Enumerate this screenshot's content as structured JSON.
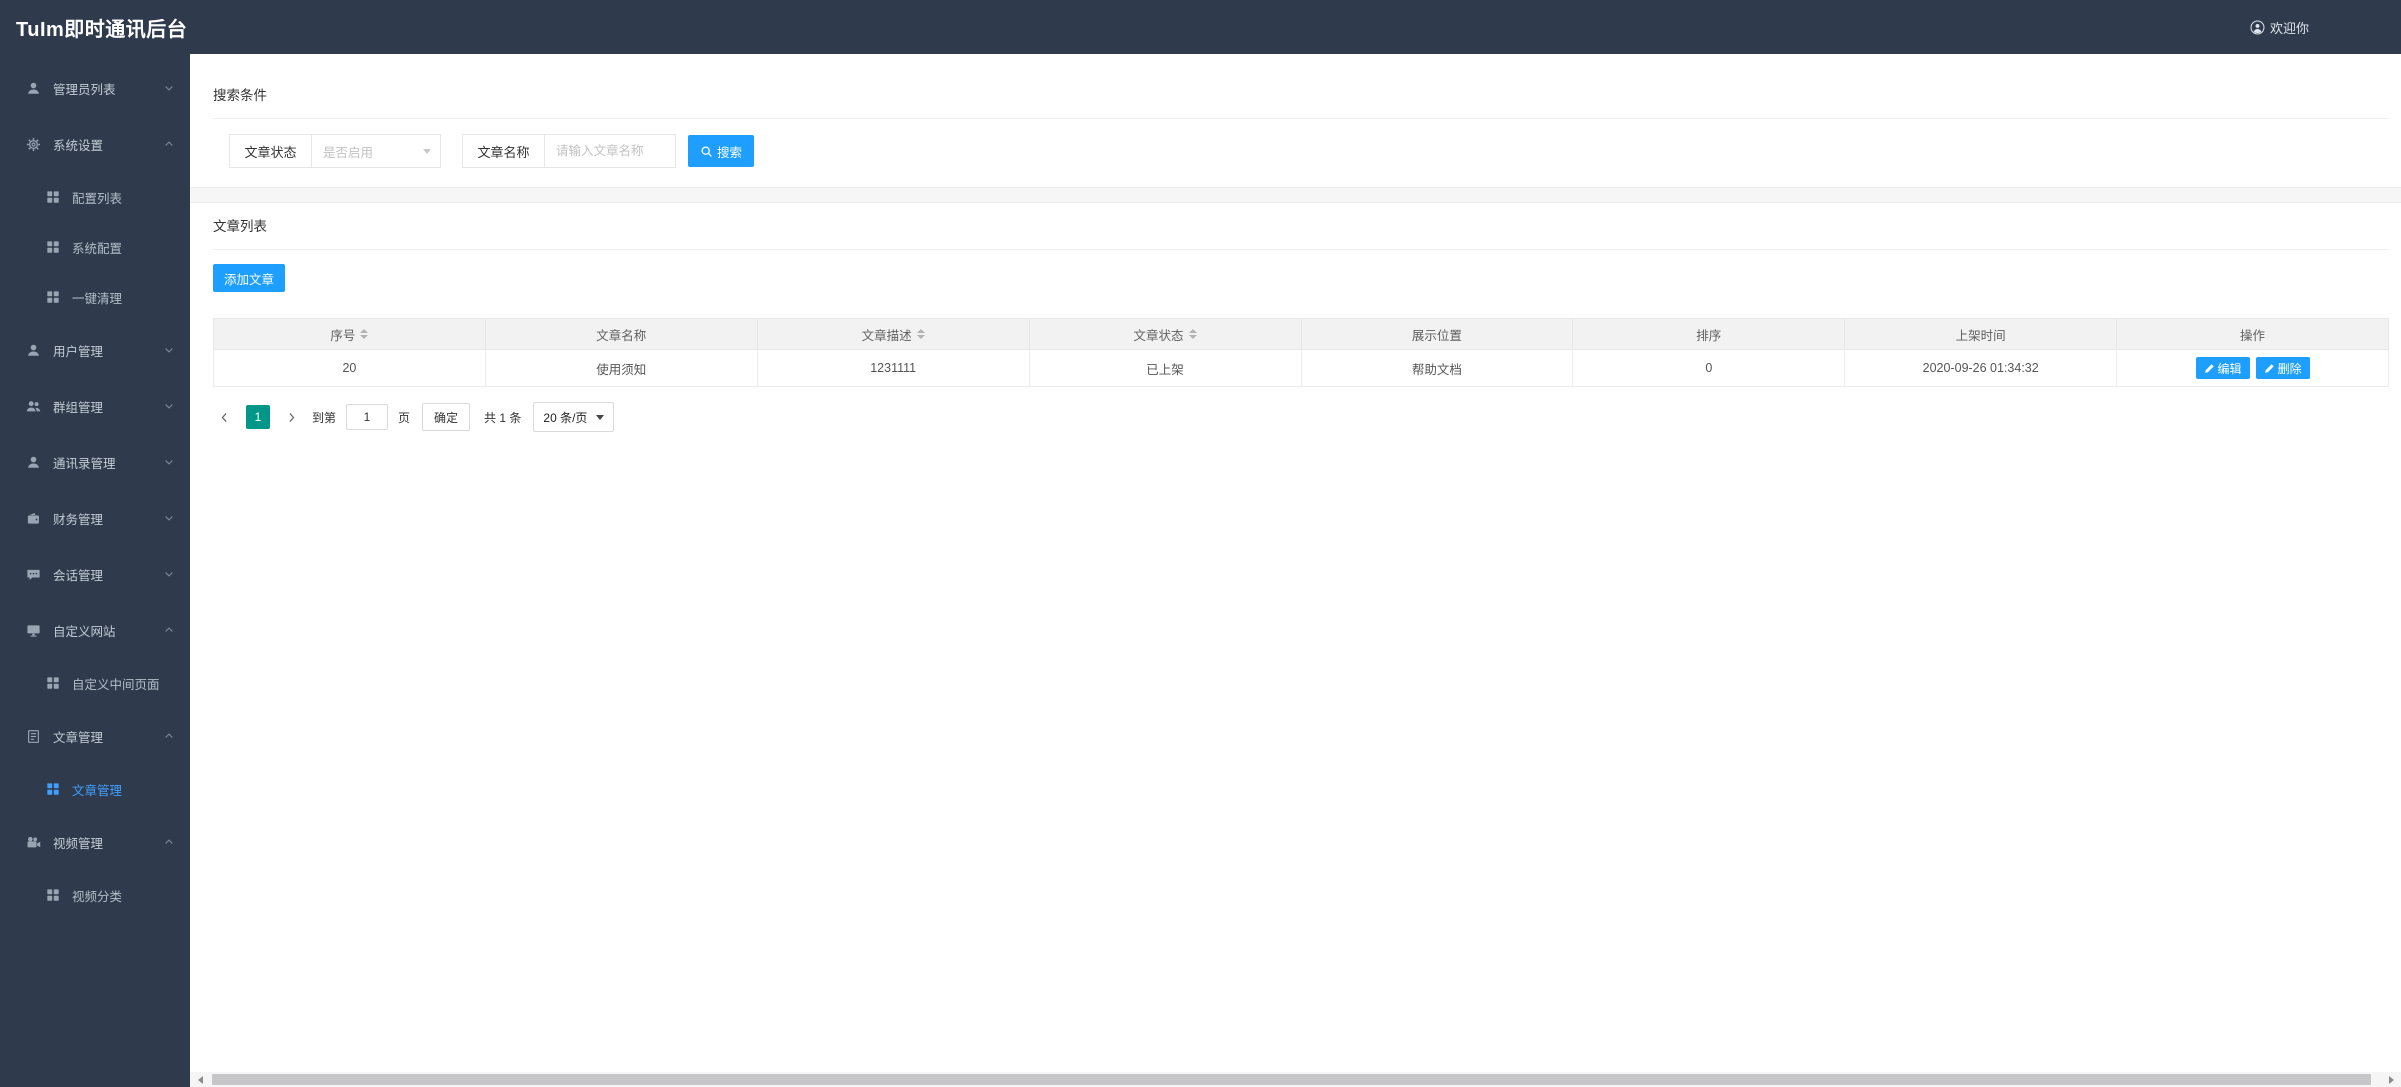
{
  "header": {
    "title": "TuIm即时通讯后台",
    "welcome": "欢迎你"
  },
  "sidebar": {
    "items": [
      {
        "label": "管理员列表",
        "icon": "admin-user-icon",
        "expanded": false,
        "children": []
      },
      {
        "label": "系统设置",
        "icon": "gear-icon",
        "expanded": true,
        "children": [
          {
            "label": "配置列表",
            "active": false
          },
          {
            "label": "系统配置",
            "active": false
          },
          {
            "label": "一键清理",
            "active": false
          }
        ]
      },
      {
        "label": "用户管理",
        "icon": "user-icon",
        "expanded": false,
        "children": []
      },
      {
        "label": "群组管理",
        "icon": "users-icon",
        "expanded": false,
        "children": []
      },
      {
        "label": "通讯录管理",
        "icon": "contacts-icon",
        "expanded": false,
        "children": []
      },
      {
        "label": "财务管理",
        "icon": "wallet-icon",
        "expanded": false,
        "children": []
      },
      {
        "label": "会话管理",
        "icon": "chat-icon",
        "expanded": false,
        "children": []
      },
      {
        "label": "自定义网站",
        "icon": "monitor-icon",
        "expanded": true,
        "children": [
          {
            "label": "自定义中间页面",
            "active": false
          }
        ]
      },
      {
        "label": "文章管理",
        "icon": "document-icon",
        "expanded": true,
        "children": [
          {
            "label": "文章管理",
            "active": true
          }
        ]
      },
      {
        "label": "视频管理",
        "icon": "video-icon",
        "expanded": true,
        "children": [
          {
            "label": "视频分类",
            "active": false
          }
        ]
      }
    ]
  },
  "search": {
    "section_title": "搜索条件",
    "status_label": "文章状态",
    "status_placeholder": "是否启用",
    "name_label": "文章名称",
    "name_placeholder": "请输入文章名称",
    "button_label": "搜索"
  },
  "list": {
    "section_title": "文章列表",
    "add_button_label": "添加文章",
    "columns": [
      {
        "label": "序号",
        "sortable": true
      },
      {
        "label": "文章名称",
        "sortable": false
      },
      {
        "label": "文章描述",
        "sortable": true
      },
      {
        "label": "文章状态",
        "sortable": true
      },
      {
        "label": "展示位置",
        "sortable": false
      },
      {
        "label": "排序",
        "sortable": false
      },
      {
        "label": "上架时间",
        "sortable": false
      },
      {
        "label": "操作",
        "sortable": false
      }
    ],
    "rows": [
      {
        "cells": [
          "20",
          "使用须知",
          "1231111",
          "已上架",
          "帮助文档",
          "0",
          "2020-09-26 01:34:32"
        ]
      }
    ],
    "edit_button_label": "编辑",
    "delete_button_label": "删除"
  },
  "pagination": {
    "current_page": "1",
    "goto_label": "到第",
    "goto_value": "1",
    "page_unit": "页",
    "confirm_label": "确定",
    "total_label": "共 1 条",
    "per_page_label": "20 条/页"
  },
  "colors": {
    "primary": "#1E9FFF",
    "pagination_active": "#009688",
    "sidebar_bg": "#2f3b4d",
    "active_menu": "#409EFF"
  }
}
